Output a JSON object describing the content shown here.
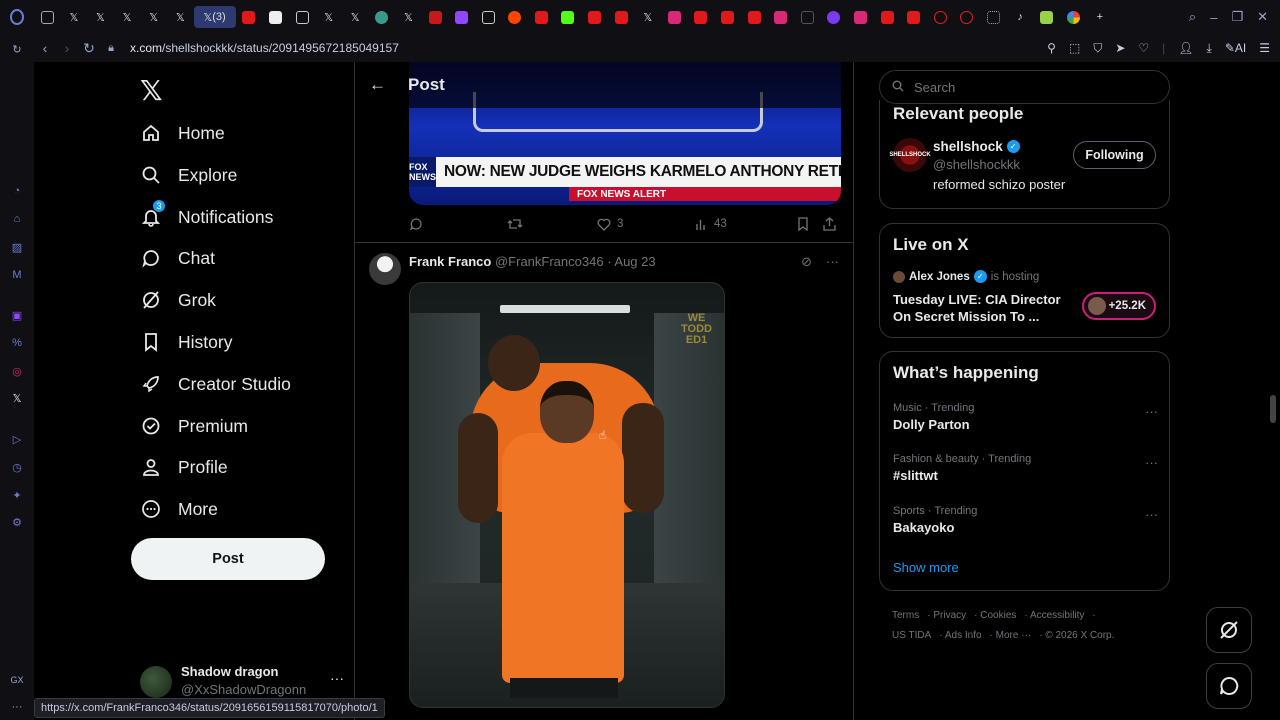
{
  "browser": {
    "active_tab_label": "(3)",
    "url_host": "x.com",
    "url_path": "/shellshockkk/status/2091495672185049157",
    "ai_label": "AI",
    "status_url": "https://x.com/FrankFranco346/status/2091656159115817070/photo/1",
    "sidebar_gx": "GX"
  },
  "nav": {
    "items": [
      {
        "label": "Home",
        "icon": "home-icon"
      },
      {
        "label": "Explore",
        "icon": "search-icon"
      },
      {
        "label": "Notifications",
        "icon": "bell-icon",
        "badge": "3"
      },
      {
        "label": "Chat",
        "icon": "chat-bubble-icon"
      },
      {
        "label": "Grok",
        "icon": "grok-icon"
      },
      {
        "label": "History",
        "icon": "bookmark-icon"
      },
      {
        "label": "Creator Studio",
        "icon": "rocket-icon"
      },
      {
        "label": "Premium",
        "icon": "verified-badge-icon"
      },
      {
        "label": "Profile",
        "icon": "person-icon"
      },
      {
        "label": "More",
        "icon": "more-circle-icon"
      }
    ],
    "post_button": "Post",
    "account": {
      "name": "Shadow dragon",
      "handle": "@XxShadowDragonn"
    }
  },
  "main": {
    "title": "Post",
    "tv": {
      "fox_label": "FOX NEWS",
      "headline": "NOW: NEW JUDGE WEIGHS KARMELO ANTHONY RETRIAL",
      "alert": "FOX NEWS ALERT"
    },
    "actions": {
      "likes": "3",
      "views": "43"
    },
    "tweet": {
      "name": "Frank Franco",
      "handle": "@FrankFranco346",
      "date": "· Aug 23",
      "watermark": "WE TODD ED1"
    }
  },
  "right": {
    "search_placeholder": "Search",
    "relevant": {
      "title": "Relevant people",
      "avatar_text": "SHELLSHOCK",
      "name": "shellshock",
      "handle": "@shellshockkk",
      "bio": "reformed schizo poster",
      "button": "Following"
    },
    "live": {
      "title": "Live on X",
      "host": "Alex Jones",
      "hosting": "is hosting",
      "space_title": "Tuesday LIVE: CIA Director On Secret Mission To ...",
      "listeners": "+25.2K"
    },
    "happening": {
      "title": "What’s happening",
      "trends": [
        {
          "meta": "Music · Trending",
          "name": "Dolly Parton"
        },
        {
          "meta": "Fashion & beauty · Trending",
          "name": "#slittwt"
        },
        {
          "meta": "Sports · Trending",
          "name": "Bakayoko"
        }
      ],
      "show_more": "Show more"
    },
    "footer": {
      "line1": [
        "Terms",
        "Privacy",
        "Cookies",
        "Accessibility"
      ],
      "line2": [
        "US TIDA",
        "Ads Info",
        "More ···",
        "© 2026 X Corp."
      ]
    }
  },
  "colors": {
    "accent": "#1d9bf0",
    "bg": "#000000",
    "border": "#2f3336",
    "muted": "#71767b"
  }
}
